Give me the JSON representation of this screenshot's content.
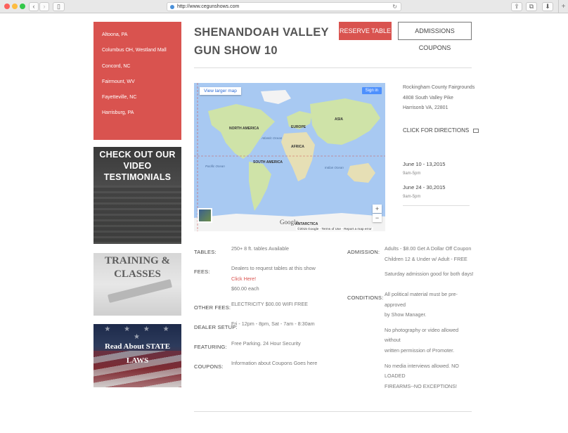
{
  "browser": {
    "url": "http://www.cegunshows.com",
    "back": "‹",
    "forward": "›",
    "sidebar_toggle": "▯",
    "share": "⇪",
    "tabs": "⧉",
    "download": "⬇",
    "reload": "↻",
    "new_tab": "+"
  },
  "sidebar": {
    "cities": [
      "Altoona, PA",
      "Columbus OH, Westland Mall",
      "Concord, NC",
      "Fairmount, WV",
      "Fayetteville, NC",
      "Harrisburg, PA"
    ],
    "promo_video": "CHECK OUT OUR VIDEO TESTIMONIALS",
    "promo_training": "TRAINING & CLASSES",
    "promo_laws": "Read About STATE LAWS",
    "stars": "★ ★ ★ ★ ★"
  },
  "header": {
    "title": "SHENANDOAH VALLEY GUN SHOW 10",
    "reserve_label": "RESERVE TABLE",
    "coupons_label": "ADMISSIONS COUPONS"
  },
  "map": {
    "view_larger": "View larger map",
    "sign_in": "Sign in",
    "zoom_in": "+",
    "zoom_out": "−",
    "google": "Google",
    "attribution": "©2015 Google · Terms of Use · Report a map error",
    "labels": {
      "north_america": "NORTH AMERICA",
      "south_america": "SOUTH AMERICA",
      "europe": "EUROPE",
      "africa": "AFRICA",
      "asia": "ASIA",
      "antarctica": "ANTARCTICA",
      "atlantic": "Atlantic Ocean",
      "pacific": "Pacific Ocean",
      "indian": "Indian Ocean"
    },
    "colors": {
      "water": "#a8c9f2",
      "land": "#cfe3a8",
      "ice": "#f3f3f3"
    }
  },
  "venue": {
    "name": "Rockingham County Fairgrounds",
    "street": "4808 South Valley Pike",
    "city": "Harrisonb VA, 22801",
    "directions_label": "CLICK FOR DIRECTIONS"
  },
  "dates": [
    {
      "date": "June 10 - 13,2015",
      "time": "9am-5pm"
    },
    {
      "date": "June 24 - 30,2015",
      "time": "9am-5pm"
    }
  ],
  "details": {
    "tables_label": "TABLES:",
    "tables_value": "250+ 8 ft. tables Available",
    "fees_label": "FEES:",
    "fees_line1": "Dealers to request tables at this show",
    "fees_link": "Click Here!",
    "fees_line3": "$60.00 each",
    "other_fees_label": "OTHER FEES:",
    "other_fees_value": "ELECTRICITY $00.00 WIFI FREE",
    "dealer_setup_label": "DEALER SETUP:",
    "dealer_setup_value": "Fri - 12pm - 8pm, Sat - 7am - 8:30am",
    "featuring_label": "FEATURING:",
    "featuring_value": "Free Parking. 24 Hour Security",
    "coupons_label": "COUPONS:",
    "coupons_value": "Information about Coupons Goes here",
    "admission_label": "ADMISSION:",
    "admission_line1": "Adults - $8.00 Get A Dollar Off Coupon",
    "admission_line2": "Children 12 & Under w/ Adult - FREE",
    "admission_line3": "Saturday admission good for both days!",
    "conditions_label": "CONDITIONS:",
    "conditions_lines": [
      "All political material must be pre-",
      "approved",
      "by Show Manager.",
      "No photography or video allowed",
      "without",
      "written permission of Promoter.",
      "No media interviews allowed. NO",
      "LOADED",
      "FIREARMS--NO EXCEPTIONS!"
    ]
  },
  "colors": {
    "accent": "#d9534f",
    "text": "#555555"
  }
}
